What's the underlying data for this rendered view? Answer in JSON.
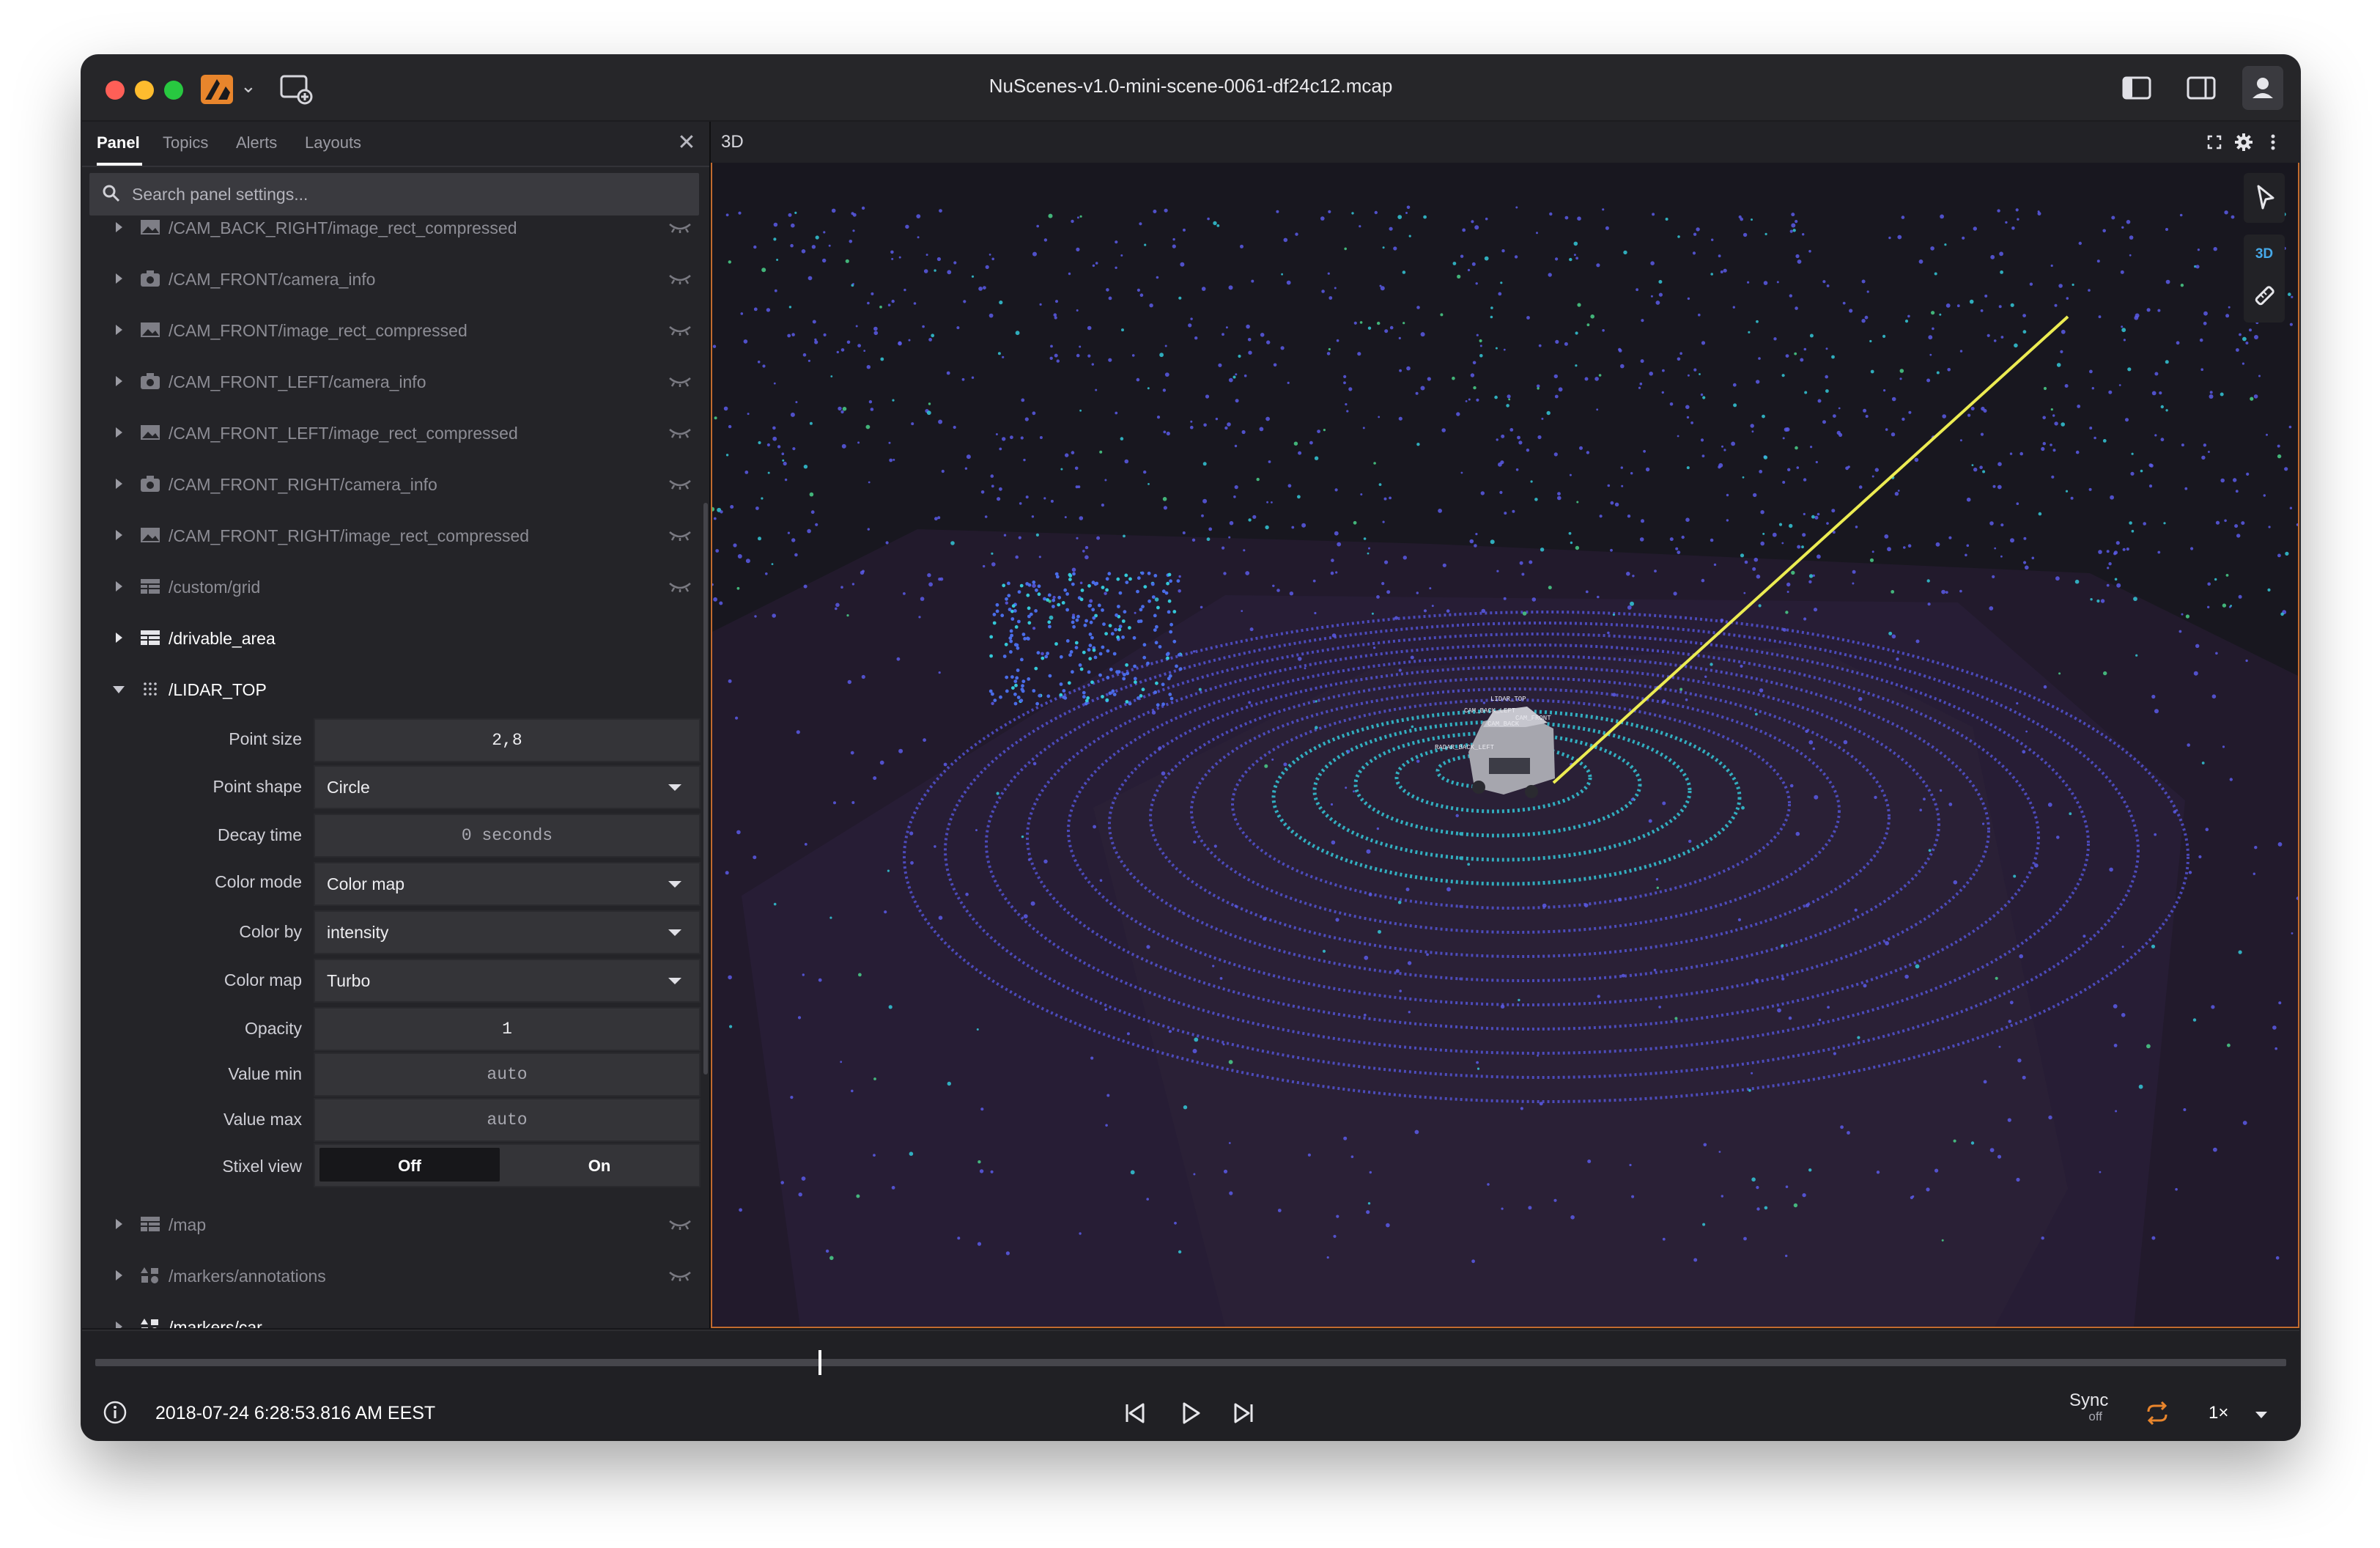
{
  "window": {
    "title": "NuScenes-v1.0-mini-scene-0061-df24c12.mcap"
  },
  "sidebar": {
    "tabs": [
      "Panel",
      "Topics",
      "Alerts",
      "Layouts"
    ],
    "search_placeholder": "Search panel settings...",
    "topics_above": [
      {
        "label": "/CAM_BACK_RIGHT/image_rect_compressed",
        "icon": "image-icon",
        "visible": false
      },
      {
        "label": "/CAM_FRONT/camera_info",
        "icon": "camera-icon",
        "visible": false
      },
      {
        "label": "/CAM_FRONT/image_rect_compressed",
        "icon": "image-icon",
        "visible": false
      },
      {
        "label": "/CAM_FRONT_LEFT/camera_info",
        "icon": "camera-icon",
        "visible": false
      },
      {
        "label": "/CAM_FRONT_LEFT/image_rect_compressed",
        "icon": "image-icon",
        "visible": false
      },
      {
        "label": "/CAM_FRONT_RIGHT/camera_info",
        "icon": "camera-icon",
        "visible": false
      },
      {
        "label": "/CAM_FRONT_RIGHT/image_rect_compressed",
        "icon": "image-icon",
        "visible": false
      },
      {
        "label": "/custom/grid",
        "icon": "grid-icon",
        "visible": false
      },
      {
        "label": "/drivable_area",
        "icon": "grid-icon",
        "visible": true
      },
      {
        "label": "/LIDAR_TOP",
        "icon": "points-icon",
        "visible": true
      }
    ],
    "lidar_settings": {
      "point_size_label": "Point size",
      "point_size": "2,8",
      "point_shape_label": "Point shape",
      "point_shape": "Circle",
      "decay_time_label": "Decay time",
      "decay_time": "0 seconds",
      "color_mode_label": "Color mode",
      "color_mode": "Color map",
      "color_by_label": "Color by",
      "color_by": "intensity",
      "color_map_label": "Color map",
      "color_map": "Turbo",
      "opacity_label": "Opacity",
      "opacity": "1",
      "value_min_label": "Value min",
      "value_min": "auto",
      "value_max_label": "Value max",
      "value_max": "auto",
      "stixel_label": "Stixel view",
      "stixel_off": "Off",
      "stixel_on": "On",
      "stixel_selected": "Off"
    },
    "topics_below": [
      {
        "label": "/map",
        "icon": "grid-icon",
        "visible": false
      },
      {
        "label": "/markers/annotations",
        "icon": "markers-icon",
        "visible": false
      },
      {
        "label": "/markers/car",
        "icon": "markers-icon",
        "visible": false
      }
    ]
  },
  "panel": {
    "title": "3D",
    "toolbar_label": "3D",
    "car_labels": [
      "LIDAR_TOP",
      "CAM_BACK_LEFT",
      "CAM_FRONT",
      "CAM_BACK",
      "RADAR_BACK_LEFT"
    ]
  },
  "playback": {
    "timestamp": "2018-07-24 6:28:53.816 AM EEST",
    "progress": 0.33,
    "sync_label": "Sync",
    "sync_state": "off",
    "speed": "1×"
  },
  "colors": {
    "accent": "#c26b2f",
    "lidar_ring": "#5a5ae8",
    "lidar_bright": "#34c8d8",
    "ray": "#f0f050"
  }
}
